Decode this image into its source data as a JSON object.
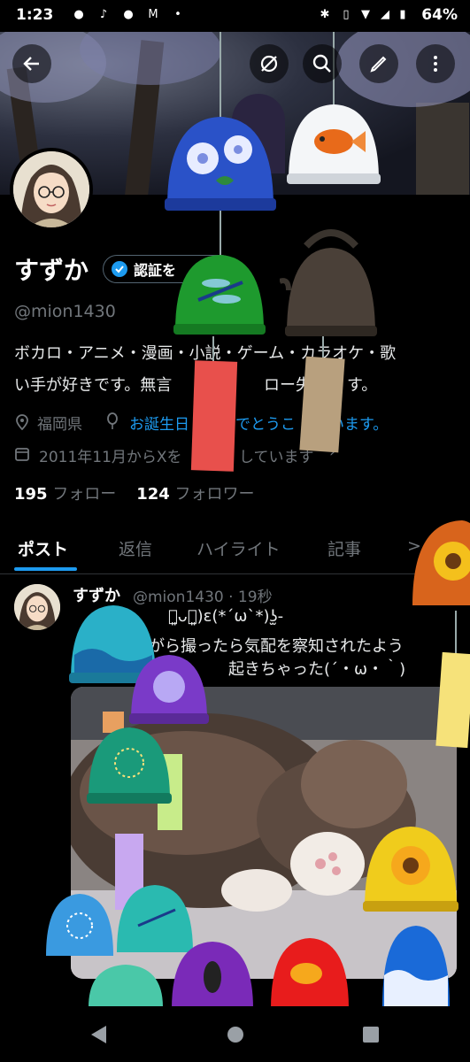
{
  "status_bar": {
    "time": "1:23",
    "battery": "64%"
  },
  "header_actions": [
    "back-arrow-icon",
    "grok-icon",
    "search-icon",
    "edit-icon",
    "more-icon"
  ],
  "profile": {
    "display_name": "すずか",
    "verify_label": "認証を",
    "handle": "@mion1430",
    "bio_line1": "ボカロ・アニメ・漫画・小説・ゲーム・カラオケ・歌",
    "bio_line2": "い手が好きです。無言",
    "bio_line2_tail": "ロー失礼し",
    "bio_line2_end": "す。",
    "location": "福岡県",
    "birthday_a": "お誕生日",
    "birthday_b": "でとうこ",
    "birthday_c": "います。",
    "joined_a": "2011年11月からXを",
    "joined_b": "しています",
    "following_count": "195",
    "following_label": "フォロー",
    "followers_count": "124",
    "followers_label": "フォロワー"
  },
  "tabs": [
    "ポスト",
    "返信",
    "ハイライト",
    "記事"
  ],
  "post": {
    "author": "すずか",
    "handle_time": "@mion1430 · 19秒",
    "line1": "・͈ᴗ・͈)ε(*´ω`*)ʖ̫-",
    "line2": "ながら撮ったら気配を察知されたよう",
    "line3": "起きちゃった(´・ω・｀)"
  },
  "colors": {
    "accent": "#1d9bf0",
    "muted": "#71767b"
  }
}
